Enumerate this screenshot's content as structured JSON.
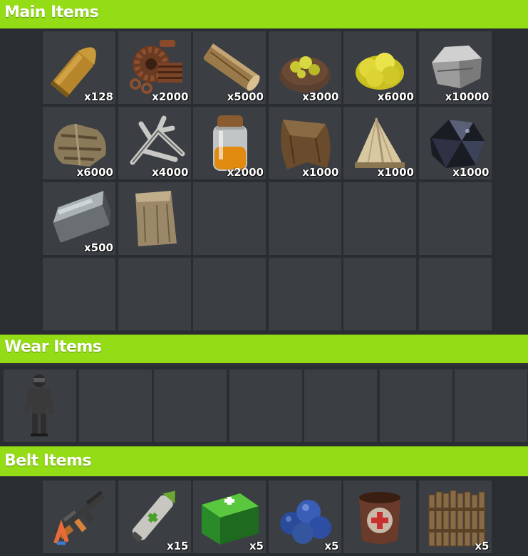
{
  "main": {
    "title": "Main Items",
    "slots": [
      {
        "item": "rifle-ammo",
        "qty": "x128"
      },
      {
        "item": "metal-fragments",
        "qty": "x2000"
      },
      {
        "item": "wood",
        "qty": "x5000"
      },
      {
        "item": "sulfur-ore",
        "qty": "x3000"
      },
      {
        "item": "sulfur",
        "qty": "x6000"
      },
      {
        "item": "stone",
        "qty": "x10000"
      },
      {
        "item": "cloth",
        "qty": "x6000"
      },
      {
        "item": "bone-fragments",
        "qty": "x4000"
      },
      {
        "item": "low-grade-fuel",
        "qty": "x2000"
      },
      {
        "item": "leather",
        "qty": "x1000"
      },
      {
        "item": "animal-fat",
        "qty": "x1000"
      },
      {
        "item": "charcoal",
        "qty": "x1000"
      },
      {
        "item": "high-quality-metal",
        "qty": "x500"
      },
      {
        "item": "explosives-bag",
        "qty": ""
      },
      {
        "item": "",
        "qty": ""
      },
      {
        "item": "",
        "qty": ""
      },
      {
        "item": "",
        "qty": ""
      },
      {
        "item": "",
        "qty": ""
      },
      {
        "item": "",
        "qty": ""
      },
      {
        "item": "",
        "qty": ""
      },
      {
        "item": "",
        "qty": ""
      },
      {
        "item": "",
        "qty": ""
      },
      {
        "item": "",
        "qty": ""
      },
      {
        "item": "",
        "qty": ""
      }
    ]
  },
  "wear": {
    "title": "Wear Items",
    "slots": [
      {
        "item": "hazmat-suit",
        "qty": ""
      },
      {
        "item": "",
        "qty": ""
      },
      {
        "item": "",
        "qty": ""
      },
      {
        "item": "",
        "qty": ""
      },
      {
        "item": "",
        "qty": ""
      },
      {
        "item": "",
        "qty": ""
      },
      {
        "item": "",
        "qty": ""
      }
    ]
  },
  "belt": {
    "title": "Belt Items",
    "slots": [
      {
        "item": "assault-rifle",
        "qty": ""
      },
      {
        "item": "medical-syringe",
        "qty": "x15"
      },
      {
        "item": "medkit",
        "qty": "x5"
      },
      {
        "item": "blueberries",
        "qty": "x5"
      },
      {
        "item": "large-medkit-pot",
        "qty": ""
      },
      {
        "item": "wooden-barricade",
        "qty": "x5"
      }
    ]
  }
}
